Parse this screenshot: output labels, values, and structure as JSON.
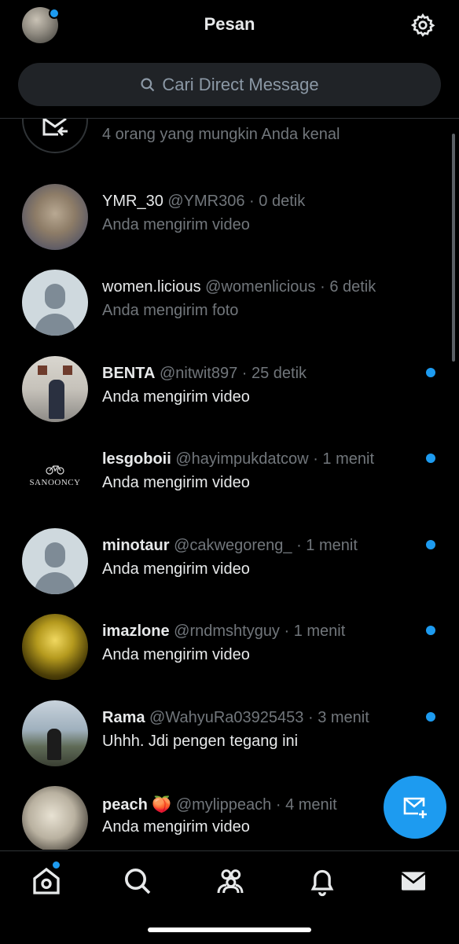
{
  "header": {
    "title": "Pesan"
  },
  "search": {
    "placeholder": "Cari Direct Message"
  },
  "requests": {
    "subtitle": "4 orang yang mungkin Anda kenal"
  },
  "conversations": [
    {
      "name": "YMR_30",
      "handle": "@YMR306",
      "sep": " · ",
      "time": "0 detik",
      "message": "Anda mengirim video",
      "unread": false
    },
    {
      "name": "women.licious",
      "handle": "@womenlicious",
      "sep": " · ",
      "time": "6 detik",
      "message": "Anda mengirim foto",
      "unread": false
    },
    {
      "name": "BENTA",
      "handle": "@nitwit897",
      "sep": " · ",
      "time": "25 detik",
      "message": "Anda mengirim video",
      "unread": true
    },
    {
      "name": "lesgoboii",
      "handle": "@hayimpukdatcow",
      "sep": " · ",
      "time": "1 menit",
      "message": "Anda mengirim video",
      "unread": true
    },
    {
      "name": "minotaur",
      "handle": "@cakwegoreng_",
      "sep": " · ",
      "time": "1 menit",
      "message": "Anda mengirim video",
      "unread": true
    },
    {
      "name": "imazlone",
      "handle": "@rndmshtyguy",
      "sep": " · ",
      "time": "1 menit",
      "message": "Anda mengirim video",
      "unread": true
    },
    {
      "name": "Rama",
      "handle": "@WahyuRa03925453",
      "sep": " · ",
      "time": "3 menit",
      "message": "Uhhh. Jdi pengen tegang ini",
      "unread": true
    },
    {
      "name": "peach 🍑",
      "handle": "@mylippeach",
      "sep": " · ",
      "time": "4 menit",
      "message": "Anda mengirim video",
      "unread": true
    }
  ],
  "avatar_texts": {
    "lesgoboii_logo": "SANOONCY"
  },
  "colors": {
    "background": "#000000",
    "accent": "#1d9bf0",
    "secondary_text": "#71767b",
    "search_bg": "#202327"
  },
  "icons": {
    "settings": "gear-icon",
    "search": "search-icon",
    "message_requests": "envelope-arrow-icon",
    "new_message": "envelope-plus-icon",
    "tabs": [
      "home-icon",
      "search-icon",
      "communities-icon",
      "bell-icon",
      "envelope-icon"
    ]
  }
}
